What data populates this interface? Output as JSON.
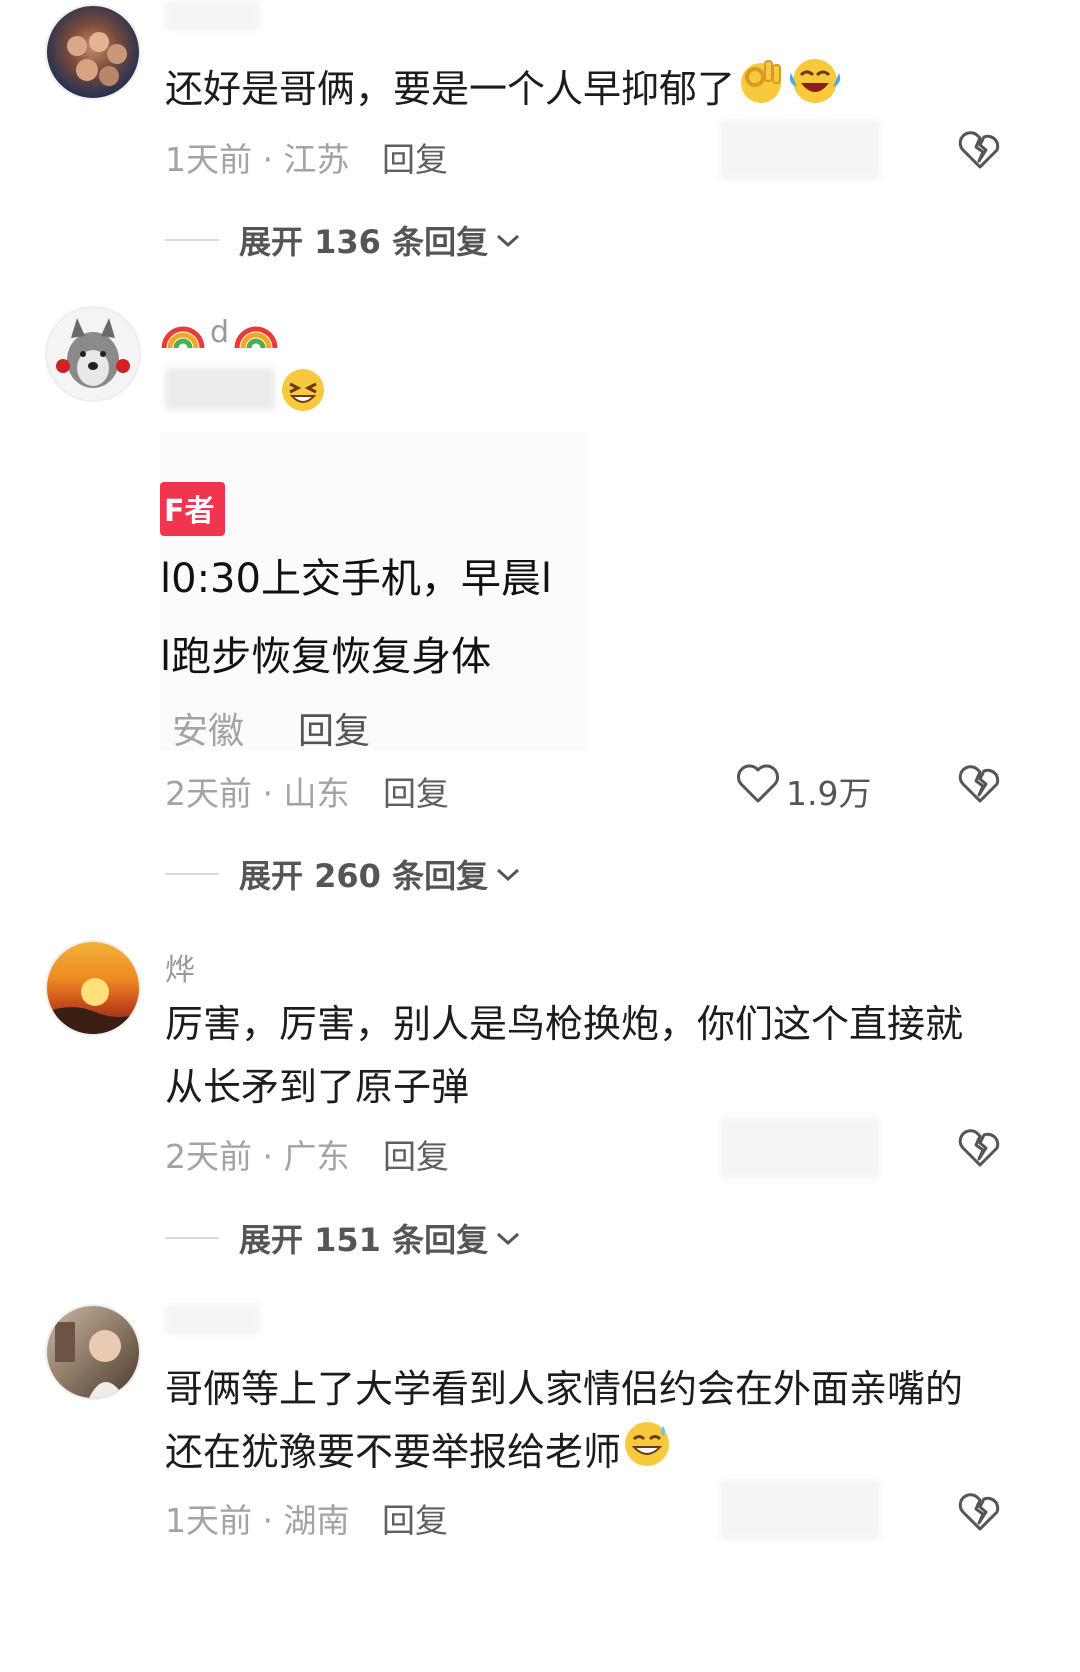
{
  "comments": [
    {
      "text": "还好是哥俩，要是一个人早抑郁了",
      "time_location": "1天前 · 江苏",
      "reply_label": "回复",
      "expand_label": "展开 136 条回复"
    },
    {
      "name_mid": "d",
      "quote_badge": "F者",
      "quote_line1": "l0:30上交手机，早晨l",
      "quote_line2": "l跑步恢复恢复身体",
      "quote_location": "安徽",
      "quote_reply": "回复",
      "time_location": "2天前 · 山东",
      "reply_label": "回复",
      "like_count": "1.9万",
      "expand_label": "展开 260 条回复"
    },
    {
      "name": "烨",
      "text_line1": "厉害，厉害，别人是鸟枪换炮，你们这个直接就",
      "text_line2": "从长矛到了原子弹",
      "time_location": "2天前 · 广东",
      "reply_label": "回复",
      "expand_label": "展开 151 条回复"
    },
    {
      "text_line1": "哥俩等上了大学看到人家情侣约会在外面亲嘴的",
      "text_line2": "还在犹豫要不要举报给老师",
      "time_location": "1天前 · 湖南",
      "reply_label": "回复"
    }
  ]
}
